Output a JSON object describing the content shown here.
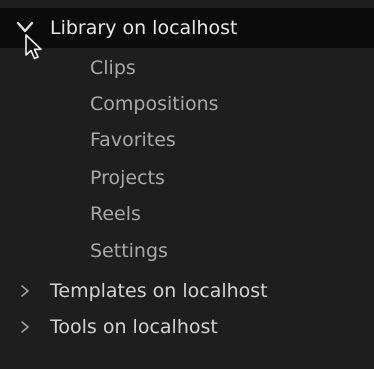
{
  "library": {
    "label": "Library on localhost",
    "expanded": true,
    "children": [
      "Clips",
      "Compositions",
      "Favorites",
      "Projects",
      "Reels",
      "Settings"
    ]
  },
  "templates": {
    "label": "Templates on localhost",
    "expanded": false
  },
  "tools": {
    "label": "Tools on localhost",
    "expanded": false
  },
  "icons": {
    "expanded": "chevron-down-icon",
    "collapsed": "chevron-right-icon",
    "pointer": "mouse-pointer-icon"
  },
  "colors": {
    "background": "#1e1e1e",
    "selected_row": "#0b0b0b",
    "text_primary": "#e8e8e8",
    "text_secondary": "#a9a9a9"
  }
}
